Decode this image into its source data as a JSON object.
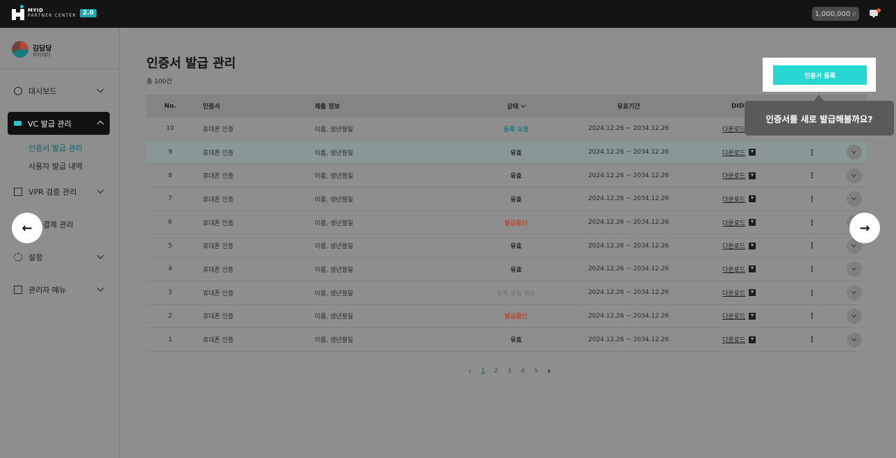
{
  "header": {
    "logo_top": "MYID",
    "logo_bottom": "PARTNER CENTER",
    "version_badge": "2.0",
    "points_value": "1,000,000",
    "points_unit": "p"
  },
  "profile": {
    "name": "김담당",
    "role": "파리에타"
  },
  "sidebar": {
    "items": [
      {
        "label": "대시보드",
        "icon": "dashboard-icon"
      },
      {
        "label": "VC 발급 관리",
        "icon": "card-icon",
        "active": true
      },
      {
        "label": "VPR 검증 관리",
        "icon": "checkbox-icon"
      },
      {
        "label": "제 / 결제 관리",
        "icon": "payment-icon"
      },
      {
        "label": "설정",
        "icon": "gear-icon"
      },
      {
        "label": "관리자 메뉴",
        "icon": "admin-icon"
      }
    ],
    "sub_items": [
      "인증서 발급 관리",
      "사용자 발급 내역"
    ]
  },
  "page": {
    "title": "인증서 발급 관리",
    "total": "총 100건",
    "register_button": "인증서 등록",
    "tooltip": "인증서를 새로 발급해볼까요?"
  },
  "table": {
    "headers": {
      "no": "No.",
      "cert": "인증서",
      "submit": "제출 정보",
      "status": "상태",
      "period": "유효기간",
      "did": "DID"
    },
    "rows": [
      {
        "no": "10",
        "cert": "휴대폰 인증",
        "submit": "이름, 생년월일",
        "status": "등록 요청",
        "period": "2024.12.26 ~ 2034.12.26",
        "download": "다운로드"
      },
      {
        "no": "9",
        "cert": "휴대폰 인증",
        "submit": "이름, 생년월일",
        "status": "유효",
        "period": "2024.12.26 ~ 2034.12.26",
        "download": "다운로드"
      },
      {
        "no": "8",
        "cert": "휴대폰 인증",
        "submit": "이름, 생년월일",
        "status": "유효",
        "period": "2024.12.26 ~ 2034.12.26",
        "download": "다운로드"
      },
      {
        "no": "7",
        "cert": "휴대폰 인증",
        "submit": "이름, 생년월일",
        "status": "유효",
        "period": "2024.12.26 ~ 2034.12.26",
        "download": "다운로드"
      },
      {
        "no": "6",
        "cert": "휴대폰 인증",
        "submit": "이름, 생년월일",
        "status": "발급중단",
        "period": "2024.12.26 ~ 2034.12.26",
        "download": "다운로드"
      },
      {
        "no": "5",
        "cert": "휴대폰 인증",
        "submit": "이름, 생년월일",
        "status": "유효",
        "period": "2024.12.26 ~ 2034.12.26",
        "download": "다운로드"
      },
      {
        "no": "4",
        "cert": "휴대폰 인증",
        "submit": "이름, 생년월일",
        "status": "유효",
        "period": "2024.12.26 ~ 2034.12.26",
        "download": "다운로드"
      },
      {
        "no": "3",
        "cert": "휴대폰 인증",
        "submit": "이름, 생년월일",
        "status": "등록 요청 취소",
        "period": "2024.12.26 ~ 2034.12.26",
        "download": "다운로드"
      },
      {
        "no": "2",
        "cert": "휴대폰 인증",
        "submit": "이름, 생년월일",
        "status": "발급중단",
        "period": "2024.12.26 ~ 2034.12.26",
        "download": "다운로드"
      },
      {
        "no": "1",
        "cert": "휴대폰 인증",
        "submit": "이름, 생년월일",
        "status": "유효",
        "period": "2024.12.26 ~ 2034.12.26",
        "download": "다운로드"
      }
    ],
    "more_glyph": "⋮"
  },
  "pagination": {
    "prev": "‹",
    "pages": [
      "1",
      "2",
      "3",
      "4",
      "5"
    ],
    "current": "1",
    "next": "›"
  },
  "carousel": {
    "left": "←",
    "right": "→"
  },
  "colors": {
    "accent": "#26d7d2",
    "tooltip_bg": "#5a5a5a",
    "topbar": "#141414"
  }
}
